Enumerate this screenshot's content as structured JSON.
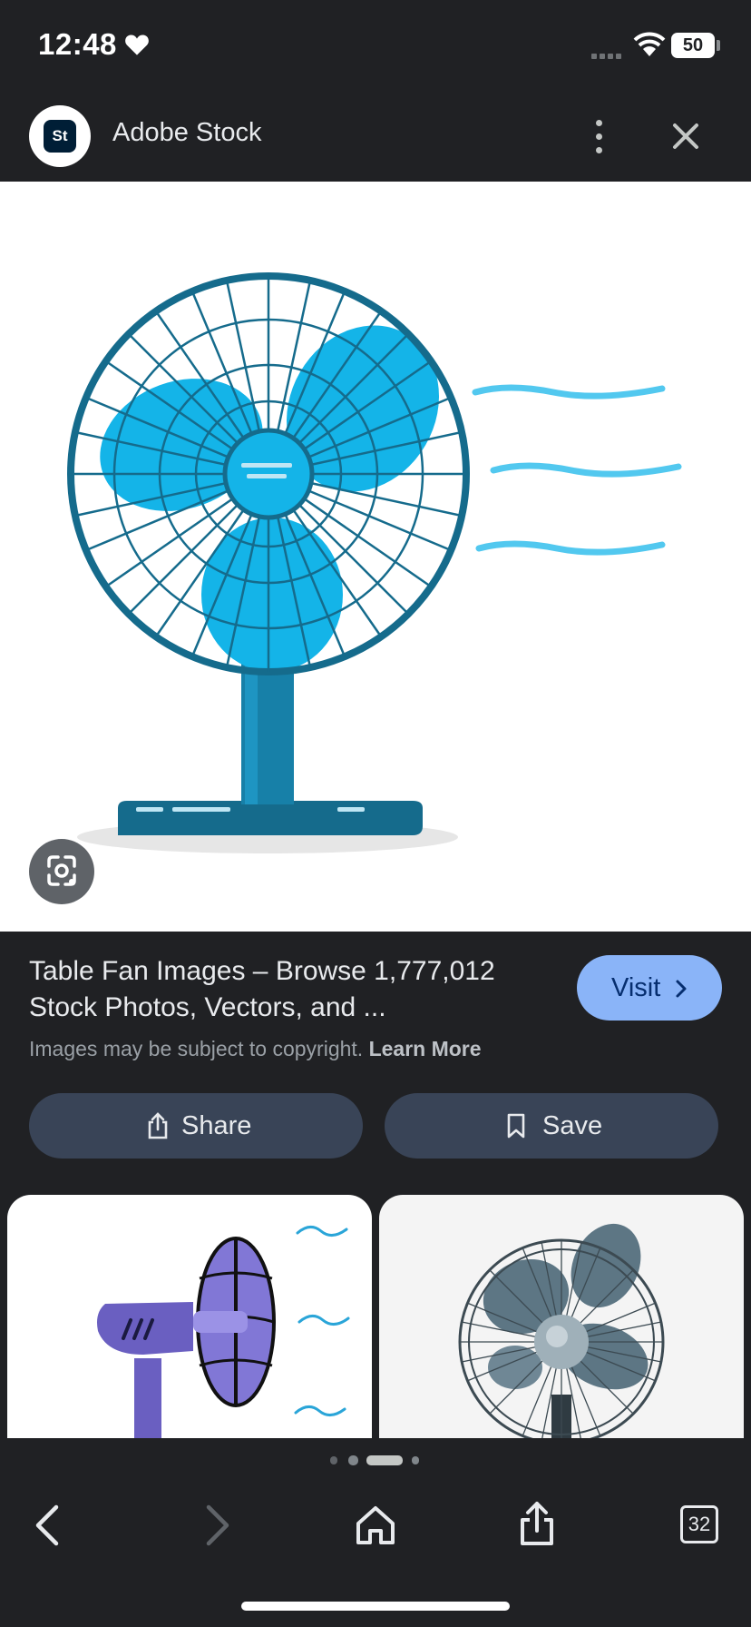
{
  "status_bar": {
    "time": "12:48",
    "battery": "50",
    "icons": [
      "heart-icon",
      "signal-icon",
      "wifi-icon",
      "battery-icon"
    ]
  },
  "header": {
    "site_logo_text": "St",
    "site_name": "Adobe Stock"
  },
  "result": {
    "title": "Table Fan Images – Browse 1,777,012 Stock Photos, Vectors, and ...",
    "visit_label": "Visit",
    "copyright_notice": "Images may be subject to copyright.",
    "learn_more": "Learn More"
  },
  "actions": {
    "share_label": "Share",
    "save_label": "Save"
  },
  "bottom_nav": {
    "tab_count": "32",
    "page_dot_count": 4,
    "active_dot_index": 2
  },
  "colors": {
    "background": "#202124",
    "accent_button": "#8ab4f8",
    "action_button": "#394457",
    "fan_blue": "#14b4e8",
    "fan_teal": "#156b8c"
  }
}
